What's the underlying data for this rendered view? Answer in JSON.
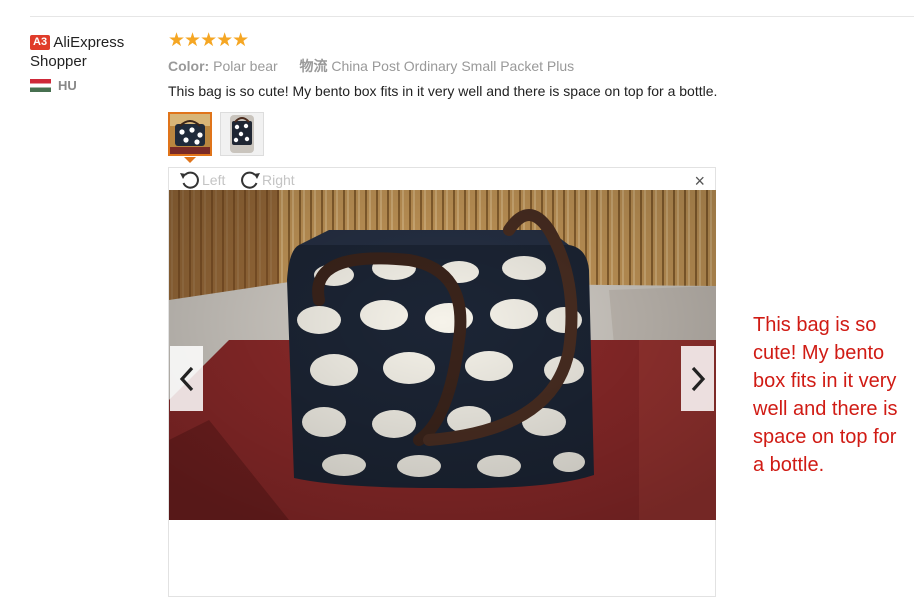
{
  "reviewer": {
    "badge": "A3",
    "name": "AliExpress Shopper",
    "country_code": "HU"
  },
  "rating": {
    "stars": 5,
    "max": 5,
    "glyphs": "★★★★★"
  },
  "order_info": {
    "color_label": "Color:",
    "color_value": "Polar bear",
    "shipping_label": "物流",
    "shipping_value": "China Post Ordinary Small Packet Plus"
  },
  "review_text": "This bag is so cute! My bento box fits in it very well and there is space on top for a bottle.",
  "viewer": {
    "rotate_left_label": "Left",
    "rotate_right_label": "Right",
    "close_glyph": "×",
    "selected_thumbnail": 1,
    "thumbnail_count": 2
  },
  "side_caption": "This bag is so cute! My bento box fits in it very well and there is space on top for a bottle.",
  "colors": {
    "accent": "#e0741a",
    "star": "#f5a623",
    "caption_red": "#d01b14",
    "badge_red": "#e03c2a"
  },
  "icons": [
    "rotate-left-icon",
    "rotate-right-icon",
    "close-icon",
    "chevron-left-icon",
    "chevron-right-icon",
    "flag-hu-icon"
  ]
}
